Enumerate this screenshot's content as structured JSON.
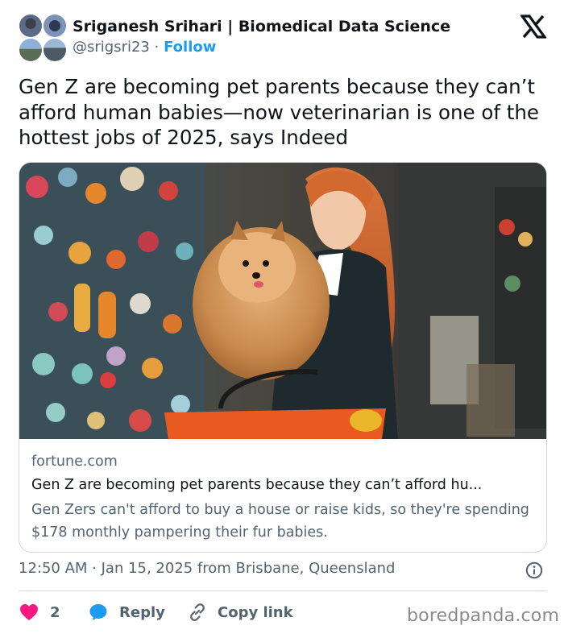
{
  "header": {
    "display_name": "Sriganesh Srihari | Biomedical Data Science",
    "handle": "@srigsri23",
    "separator": "·",
    "follow_label": "Follow",
    "platform_icon": "x-logo-icon"
  },
  "tweet": {
    "text": "Gen Z are becoming pet parents because they can’t afford human babies—now veterinarian is one of the hottest jobs of 2025, says Indeed"
  },
  "card": {
    "domain": "fortune.com",
    "title": "Gen Z are becoming pet parents because they can’t afford hu...",
    "description": "Gen Zers can't afford to buy a house or raise kids, so they're spending $178 monthly pampering their fur babies."
  },
  "meta": {
    "timestamp": "12:50 AM · Jan 15, 2025 from Brisbane, Queensland",
    "info_icon": "info-icon"
  },
  "actions": {
    "like_count": "2",
    "reply_label": "Reply",
    "copy_link_label": "Copy link"
  },
  "watermark": "boredpanda.com",
  "colors": {
    "accent": "#1d9bf0",
    "like": "#f91880",
    "text": "#0f1419",
    "secondary": "#536471",
    "border": "#cfd9de"
  }
}
